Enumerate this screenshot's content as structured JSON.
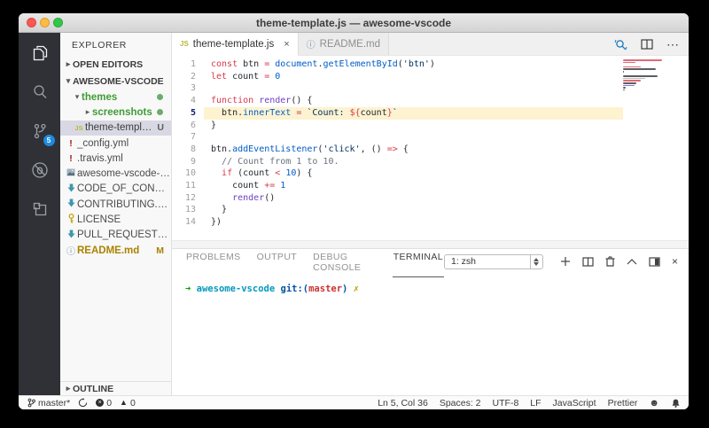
{
  "window": {
    "title": "theme-template.js — awesome-vscode"
  },
  "activity_bar": {
    "source_control_badge": "5"
  },
  "sidebar": {
    "title": "EXPLORER",
    "sections": {
      "open_editors": "OPEN EDITORS",
      "root": "AWESOME-VSCODE",
      "outline": "OUTLINE"
    },
    "items": [
      {
        "label": "themes"
      },
      {
        "label": "screenshots"
      },
      {
        "label": "theme-template...",
        "badge": "U"
      },
      {
        "label": "_config.yml"
      },
      {
        "label": ".travis.yml"
      },
      {
        "label": "awesome-vscode-logo.."
      },
      {
        "label": "CODE_OF_CONDUCT..."
      },
      {
        "label": "CONTRIBUTING.md"
      },
      {
        "label": "LICENSE"
      },
      {
        "label": "PULL_REQUEST_TEMP..."
      },
      {
        "label": "README.md",
        "badge": "M"
      }
    ]
  },
  "tabs": [
    {
      "icon": "JS",
      "label": "theme-template.js",
      "close": "×"
    },
    {
      "icon": "ⓘ",
      "label": "README.md"
    }
  ],
  "editor": {
    "active_line": 5,
    "lines": [
      {
        "num": 1,
        "seg": [
          {
            "c": "k",
            "t": "const"
          },
          {
            "c": "p",
            "t": " "
          },
          {
            "c": "v",
            "t": "btn"
          },
          {
            "c": "o",
            "t": " = "
          },
          {
            "c": "f",
            "t": "document"
          },
          {
            "c": "p",
            "t": "."
          },
          {
            "c": "f",
            "t": "getElementById"
          },
          {
            "c": "p",
            "t": "("
          },
          {
            "c": "s",
            "t": "'btn'"
          },
          {
            "c": "p",
            "t": ")"
          }
        ]
      },
      {
        "num": 2,
        "seg": [
          {
            "c": "k",
            "t": "let"
          },
          {
            "c": "p",
            "t": " "
          },
          {
            "c": "v",
            "t": "count"
          },
          {
            "c": "o",
            "t": " = "
          },
          {
            "c": "n",
            "t": "0"
          }
        ]
      },
      {
        "num": 3,
        "seg": []
      },
      {
        "num": 4,
        "seg": [
          {
            "c": "k",
            "t": "function"
          },
          {
            "c": "p",
            "t": " "
          },
          {
            "c": "u",
            "t": "render"
          },
          {
            "c": "p",
            "t": "() {"
          }
        ]
      },
      {
        "num": 5,
        "hl": true,
        "seg": [
          {
            "c": "p",
            "t": "  "
          },
          {
            "c": "v",
            "t": "btn"
          },
          {
            "c": "p",
            "t": "."
          },
          {
            "c": "f",
            "t": "innerText"
          },
          {
            "c": "o",
            "t": " = "
          },
          {
            "c": "s",
            "t": "`Count: "
          },
          {
            "c": "o",
            "t": "${"
          },
          {
            "c": "v",
            "t": "count"
          },
          {
            "c": "o",
            "t": "}"
          },
          {
            "c": "s",
            "t": "`"
          }
        ]
      },
      {
        "num": 6,
        "seg": [
          {
            "c": "p",
            "t": "}"
          }
        ]
      },
      {
        "num": 7,
        "seg": []
      },
      {
        "num": 8,
        "seg": [
          {
            "c": "v",
            "t": "btn"
          },
          {
            "c": "p",
            "t": "."
          },
          {
            "c": "f",
            "t": "addEventListener"
          },
          {
            "c": "p",
            "t": "("
          },
          {
            "c": "s",
            "t": "'click'"
          },
          {
            "c": "p",
            "t": ", () "
          },
          {
            "c": "o",
            "t": "=>"
          },
          {
            "c": "p",
            "t": " {"
          }
        ]
      },
      {
        "num": 9,
        "seg": [
          {
            "c": "c",
            "t": "  // Count from 1 to 10."
          }
        ]
      },
      {
        "num": 10,
        "seg": [
          {
            "c": "p",
            "t": "  "
          },
          {
            "c": "k",
            "t": "if"
          },
          {
            "c": "p",
            "t": " ("
          },
          {
            "c": "v",
            "t": "count"
          },
          {
            "c": "o",
            "t": " < "
          },
          {
            "c": "n",
            "t": "10"
          },
          {
            "c": "p",
            "t": ") {"
          }
        ]
      },
      {
        "num": 11,
        "seg": [
          {
            "c": "p",
            "t": "    "
          },
          {
            "c": "v",
            "t": "count"
          },
          {
            "c": "o",
            "t": " += "
          },
          {
            "c": "n",
            "t": "1"
          }
        ]
      },
      {
        "num": 12,
        "seg": [
          {
            "c": "p",
            "t": "    "
          },
          {
            "c": "u",
            "t": "render"
          },
          {
            "c": "p",
            "t": "()"
          }
        ]
      },
      {
        "num": 13,
        "seg": [
          {
            "c": "p",
            "t": "  }"
          }
        ]
      },
      {
        "num": 14,
        "seg": [
          {
            "c": "p",
            "t": "})"
          }
        ]
      }
    ]
  },
  "panel": {
    "tabs": [
      "PROBLEMS",
      "OUTPUT",
      "DEBUG CONSOLE",
      "TERMINAL"
    ],
    "active_tab": "TERMINAL",
    "shell_select": "1: zsh",
    "terminal_line": [
      {
        "c": "tg",
        "t": "➜"
      },
      {
        "c": "p",
        "t": "  "
      },
      {
        "c": "tc",
        "t": "awesome-vscode"
      },
      {
        "c": "p",
        "t": " "
      },
      {
        "c": "tb",
        "t": "git:("
      },
      {
        "c": "tr",
        "t": "master"
      },
      {
        "c": "tb",
        "t": ")"
      },
      {
        "c": "p",
        "t": " "
      },
      {
        "c": "ty",
        "t": "✗"
      }
    ]
  },
  "status_bar": {
    "branch": "master*",
    "errors": "0",
    "warnings": "0",
    "right": [
      "Ln 5, Col 36",
      "Spaces: 2",
      "UTF-8",
      "LF",
      "JavaScript",
      "Prettier"
    ]
  },
  "colors": {
    "accent": "#007acc",
    "keyword": "#d73a49",
    "function": "#005cc5",
    "string": "#032f62",
    "line_highlight": "#fdf3d1",
    "git_added_green": "#3f9c35",
    "git_modified_orange": "#a98300"
  }
}
